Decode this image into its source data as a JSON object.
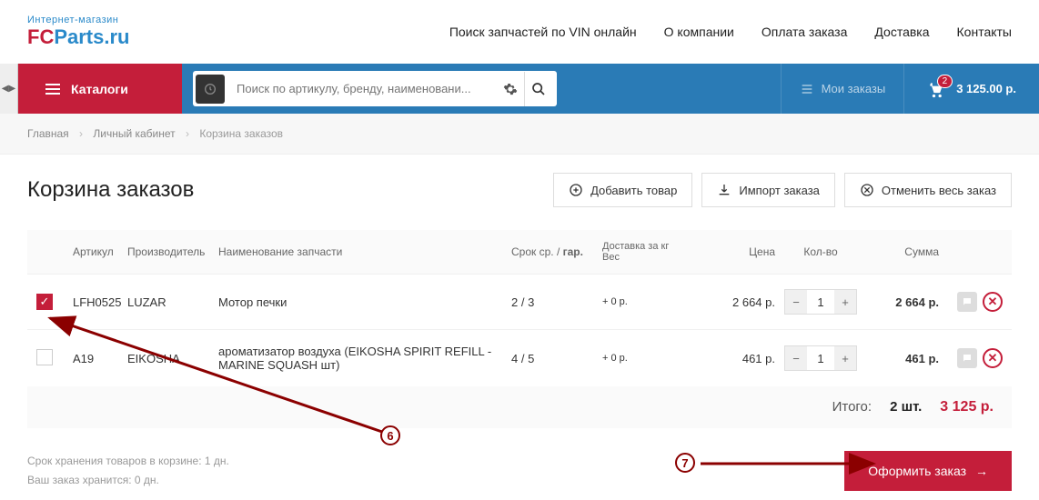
{
  "logo": {
    "subtitle": "Интернет-магазин",
    "brand_fc": "FC",
    "brand_rest": "Parts.ru"
  },
  "top_nav": [
    "Поиск запчастей по VIN онлайн",
    "О компании",
    "Оплата заказа",
    "Доставка",
    "Контакты"
  ],
  "catalog_btn": "Каталоги",
  "search": {
    "placeholder": "Поиск по артикулу, бренду, наименовани..."
  },
  "my_orders": "Мои заказы",
  "cart": {
    "count": "2",
    "total": "3 125.00 р."
  },
  "breadcrumbs": {
    "home": "Главная",
    "account": "Личный кабинет",
    "current": "Корзина заказов"
  },
  "page_title": "Корзина заказов",
  "actions": {
    "add": "Добавить товар",
    "import": "Импорт заказа",
    "cancel": "Отменить весь заказ"
  },
  "headers": {
    "article": "Артикул",
    "mfr": "Производитель",
    "name": "Наименование запчасти",
    "term": "Срок ср. / гар.",
    "ship": "Доставка за кг\nВес",
    "price": "Цена",
    "qty": "Кол-во",
    "sum": "Сумма"
  },
  "rows": [
    {
      "checked": true,
      "article": "LFH0525",
      "mfr": "LUZAR",
      "name": "Мотор печки",
      "term": "2 / 3",
      "ship": "+ 0 р.",
      "price": "2 664 р.",
      "qty": "1",
      "sum": "2 664 р."
    },
    {
      "checked": false,
      "article": "A19",
      "mfr": "EIKOSHA",
      "name": "ароматизатор воздуха (EIKOSHA SPIRIT REFILL - MARINE SQUASH шт)",
      "term": "4 / 5",
      "ship": "+ 0 р.",
      "price": "461 р.",
      "qty": "1",
      "sum": "461 р."
    }
  ],
  "totals": {
    "label": "Итого:",
    "qty": "2 шт.",
    "sum": "3 125 р."
  },
  "storage": {
    "line1": "Срок хранения товаров в корзине: 1 дн.",
    "line2": "Ваш заказ хранится: 0 дн."
  },
  "checkout": "Оформить заказ",
  "annotations": {
    "six": "6",
    "seven": "7"
  }
}
